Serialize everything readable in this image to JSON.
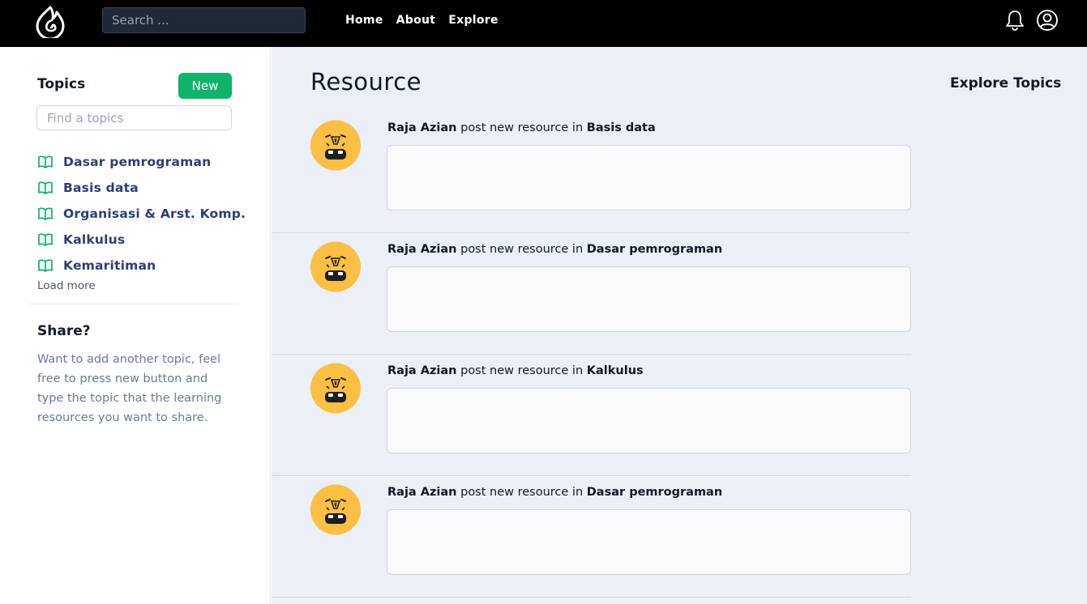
{
  "header": {
    "search_placeholder": "Search ...",
    "nav": [
      "Home",
      "About",
      "Explore"
    ]
  },
  "sidebar": {
    "title": "Topics",
    "new_label": "New",
    "find_placeholder": "Find a topics",
    "topics": [
      "Dasar pemrograman",
      "Basis data",
      "Organisasi & Arst. Komp.",
      "Kalkulus",
      "Kemaritiman"
    ],
    "load_more": "Load more",
    "share_title": "Share?",
    "share_text": "Want to add another topic, feel free to press new button and type the topic that the learning resources you want to share."
  },
  "main": {
    "title": "Resource",
    "explore_title": "Explore Topics",
    "feed": [
      {
        "user": "Raja Azian",
        "action": " post new resource in ",
        "topic": "Basis data"
      },
      {
        "user": "Raja Azian",
        "action": " post new resource in ",
        "topic": "Dasar pemrograman"
      },
      {
        "user": "Raja Azian",
        "action": " post new resource in ",
        "topic": "Kalkulus"
      },
      {
        "user": "Raja Azian",
        "action": " post new resource in ",
        "topic": "Dasar pemrograman"
      }
    ]
  },
  "colors": {
    "topbar": "#000000",
    "accent_green": "#10b26c",
    "topic_text": "#2c3e74",
    "main_bg": "#ebeff6",
    "avatar_yellow": "#fbbf45"
  },
  "icons": [
    "flame-logo-icon",
    "bell-icon",
    "user-circle-icon",
    "book-open-icon",
    "avatar-face-icon"
  ]
}
